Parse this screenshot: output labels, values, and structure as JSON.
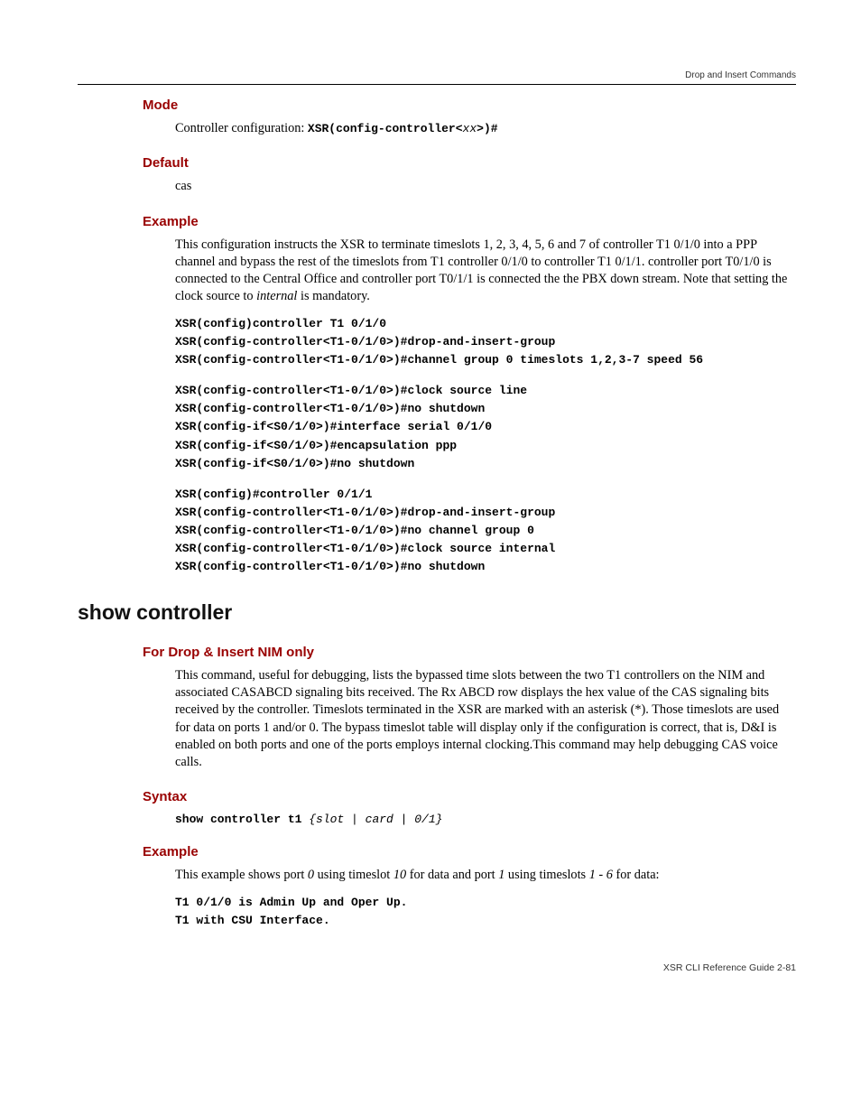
{
  "header": {
    "section_title": "Drop and Insert Commands"
  },
  "sections": {
    "mode": {
      "heading": "Mode",
      "text_prefix": "Controller configuration: ",
      "text_mono": "XSR(config-controller<",
      "text_mono_italic": "xx",
      "text_mono_suffix": ">)#"
    },
    "default": {
      "heading": "Default",
      "text": "cas"
    },
    "example1": {
      "heading": "Example",
      "paragraph_parts": {
        "p1": "This configuration instructs the XSR to terminate timeslots 1, 2, 3, 4, 5, 6 and 7 of controller T1 0/1/0 into a PPP channel and bypass the rest of the timeslots from T1 controller 0/1/0 to controller T1 0/1/1. controller port T0/1/0 is connected to the Central Office and controller port T0/1/1 is connected the the PBX down stream. Note that setting the clock source to ",
        "p1_italic": "internal",
        "p1_suffix": " is mandatory."
      },
      "code1": "XSR(config)controller T1 0/1/0\nXSR(config-controller<T1-0/1/0>)#drop-and-insert-group\nXSR(config-controller<T1-0/1/0>)#channel group 0 timeslots 1,2,3-7 speed 56",
      "code2": "XSR(config-controller<T1-0/1/0>)#clock source line\nXSR(config-controller<T1-0/1/0>)#no shutdown\nXSR(config-if<S0/1/0>)#interface serial 0/1/0\nXSR(config-if<S0/1/0>)#encapsulation ppp\nXSR(config-if<S0/1/0>)#no shutdown",
      "code3": "XSR(config)#controller 0/1/1\nXSR(config-controller<T1-0/1/0>)#drop-and-insert-group\nXSR(config-controller<T1-0/1/0>)#no channel group 0\nXSR(config-controller<T1-0/1/0>)#clock source internal\nXSR(config-controller<T1-0/1/0>)#no shutdown"
    },
    "show_controller": {
      "heading": "show controller"
    },
    "drop_insert": {
      "heading": "For Drop & Insert NIM only",
      "paragraph": "This command, useful for debugging, lists the bypassed time slots between the two T1 controllers on the NIM and associated CASABCD signaling bits received. The Rx ABCD row displays the hex value of the CAS signaling bits received by the controller. Timeslots terminated in the XSR are marked with an asterisk (*). Those timeslots are used for data on ports 1 and/or 0. The bypass timeslot table will display only if the configuration is correct, that is, D&I is enabled on both ports and one of the ports employs internal clocking.This command may help debugging CAS voice calls."
    },
    "syntax": {
      "heading": "Syntax",
      "cmd_bold": "show controller t1 ",
      "cmd_italic": "{slot | card | 0/1}"
    },
    "example2": {
      "heading": "Example",
      "para": {
        "a": "This example shows port ",
        "b": "0",
        "c": " using timeslot ",
        "d": "10",
        "e": " for data and port ",
        "f": "1",
        "g": " using timeslots ",
        "h": "1 - 6",
        "i": " for data:"
      },
      "code": "T1 0/1/0 is Admin Up and Oper Up.\nT1 with CSU Interface."
    }
  },
  "footer": {
    "text": "XSR CLI Reference Guide   2-81"
  }
}
